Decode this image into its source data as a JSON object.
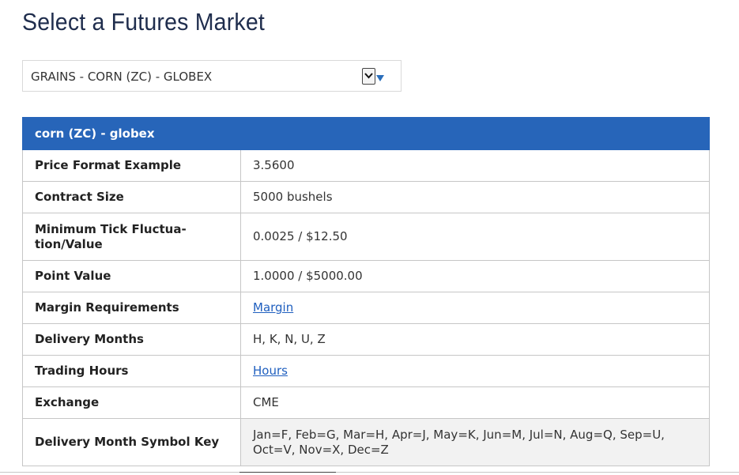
{
  "page": {
    "title": "Select a Futures Market"
  },
  "market_select": {
    "selected": "GRAINS - CORN (ZC) - GLOBEX",
    "icon": "chevron-down-icon",
    "caret_color": "#2a6ebb"
  },
  "spec_table": {
    "header": "corn (ZC) - globex",
    "header_color": "#2765b9",
    "rows": [
      {
        "label": "Price Format Example",
        "value": "3.5600"
      },
      {
        "label": "Contract Size",
        "value": "5000 bushels"
      },
      {
        "label": "Minimum Tick Fluctua-\ntion/Value",
        "value": "0.0025 / $12.50"
      },
      {
        "label": "Point Value",
        "value": "1.0000 / $5000.00"
      },
      {
        "label": "Margin Requirements",
        "value": "Margin"
      },
      {
        "label": "Delivery Months",
        "value": "H, K, N, U, Z"
      },
      {
        "label": "Trading Hours",
        "value": "Hours"
      },
      {
        "label": "Exchange",
        "value": "CME"
      },
      {
        "label": "Delivery Month Symbol Key",
        "value": "Jan=F, Feb=G, Mar=H, Apr=J, May=K, Jun=M, Jul=N, Aug=Q, Sep=U, Oct=V, Nov=X, Dec=Z"
      }
    ],
    "link_color": "#1f5fbf"
  }
}
